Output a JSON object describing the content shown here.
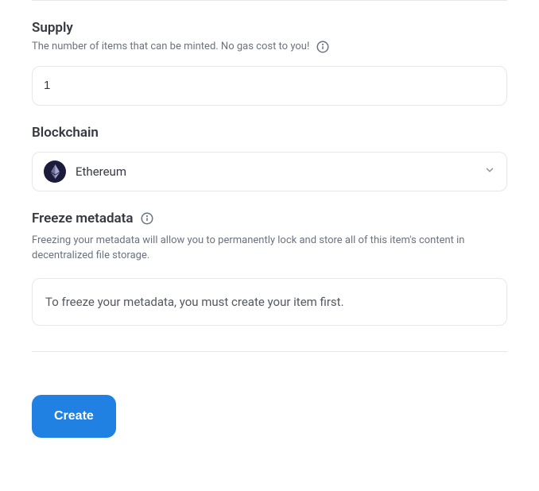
{
  "supply": {
    "title": "Supply",
    "help": "The number of items that can be minted. No gas cost to you!",
    "value": "1"
  },
  "blockchain": {
    "title": "Blockchain",
    "selected": "Ethereum"
  },
  "freeze": {
    "title": "Freeze metadata",
    "help": "Freezing your metadata will allow you to permanently lock and store all of this item's content in decentralized file storage.",
    "notice": "To freeze your metadata, you must create your item first."
  },
  "actions": {
    "create": "Create"
  }
}
